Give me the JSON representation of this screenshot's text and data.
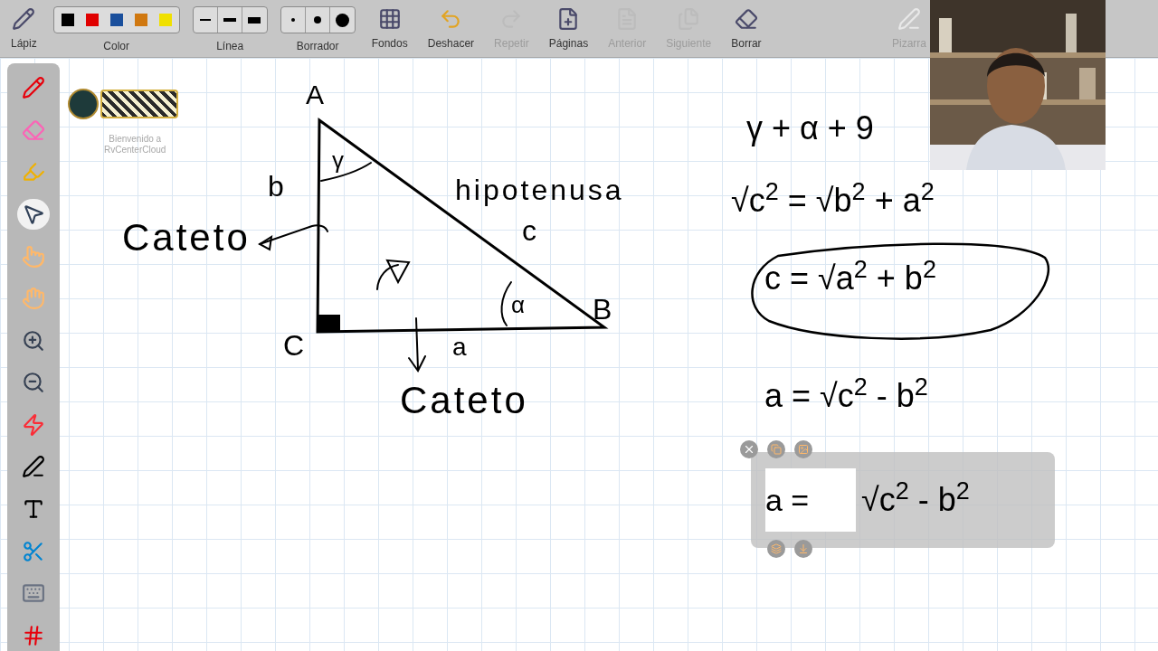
{
  "toolbar": {
    "items": [
      {
        "kind": "tool",
        "label": "Lápiz",
        "disabled": false
      },
      {
        "kind": "colors",
        "label": "Color",
        "swatches": [
          {
            "color": "#000000"
          },
          {
            "color": "#e00000"
          },
          {
            "color": "#1a4f9c"
          },
          {
            "color": "#d07810"
          },
          {
            "color": "#f0e000"
          }
        ]
      },
      {
        "kind": "lines",
        "label": "Línea"
      },
      {
        "kind": "dots",
        "label": "Borrador"
      },
      {
        "kind": "tool",
        "label": "Fondos",
        "disabled": false
      },
      {
        "kind": "tool",
        "label": "Deshacer",
        "disabled": false
      },
      {
        "kind": "tool",
        "label": "Repetir",
        "disabled": true
      },
      {
        "kind": "tool",
        "label": "Páginas",
        "disabled": false
      },
      {
        "kind": "tool",
        "label": "Anterior",
        "disabled": true
      },
      {
        "kind": "tool",
        "label": "Siguiente",
        "disabled": true
      },
      {
        "kind": "tool",
        "label": "Borrar",
        "disabled": false
      }
    ],
    "end": {
      "label": "Pizarra",
      "disabled": true
    }
  },
  "sidebar": {
    "tools": [
      {
        "selected": false
      },
      {
        "selected": false
      },
      {
        "selected": false
      },
      {
        "selected": true
      },
      {
        "selected": false
      },
      {
        "selected": false
      },
      {
        "selected": false
      },
      {
        "selected": false
      },
      {
        "selected": false
      },
      {
        "selected": false
      },
      {
        "selected": false
      },
      {
        "selected": false
      },
      {
        "selected": false
      },
      {
        "selected": false
      }
    ]
  },
  "canvas": {
    "caption": [
      "Bienvenido a",
      "RvCenterCloud"
    ],
    "labels": [
      {
        "text": "A"
      },
      {
        "text": "b"
      },
      {
        "text": "Cateto"
      },
      {
        "text": "hipotenusa"
      },
      {
        "text": "c"
      },
      {
        "text": "C"
      },
      {
        "text": "a"
      },
      {
        "text": "B"
      },
      {
        "text": "Cateto"
      },
      {
        "text": "γ"
      },
      {
        "text": "α"
      },
      {
        "text": "γ + α + 9"
      },
      {
        "text": "√c$^{2}$ = √b$^{2}$ + a$^{2}$"
      },
      {
        "text": "c = √a$^{2}$ + b$^{2}$"
      },
      {
        "text": "a = √c$^{2}$ - b$^{2}$"
      }
    ],
    "selection": {
      "left": "a =",
      "right": "√c$^{2}$ - b$^{2}$"
    }
  }
}
